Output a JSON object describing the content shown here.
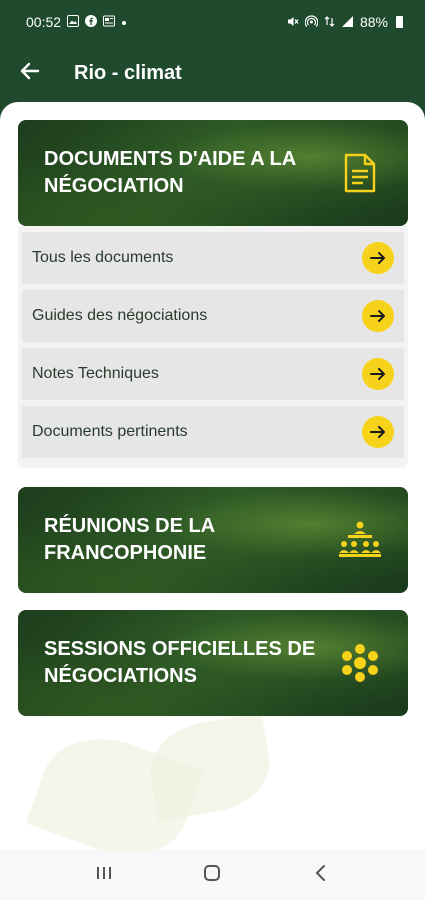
{
  "status_bar": {
    "time": "00:52",
    "battery": "88%"
  },
  "app_bar": {
    "title": "Rio - climat"
  },
  "sections": [
    {
      "title": "DOCUMENTS D'AIDE A LA NÉGOCIATION",
      "icon": "document-icon",
      "items": [
        {
          "label": "Tous les documents"
        },
        {
          "label": "Guides des négociations"
        },
        {
          "label": "Notes Techniques"
        },
        {
          "label": "Documents pertinents"
        }
      ]
    },
    {
      "title": "RÉUNIONS DE LA FRANCOPHONIE",
      "icon": "meeting-icon"
    },
    {
      "title": "SESSIONS OFFICIELLES DE NÉGOCIATIONS",
      "icon": "group-icon"
    }
  ],
  "colors": {
    "primary": "#1f4a2e",
    "accent": "#f7d21a",
    "item_bg": "#e6e6e6"
  }
}
